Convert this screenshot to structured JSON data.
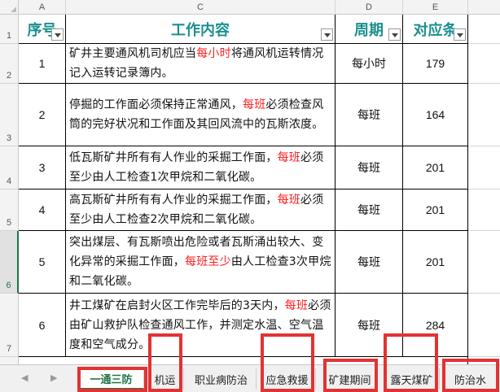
{
  "columns": [
    "A",
    "C",
    "D",
    "E"
  ],
  "header_row_number": "1",
  "headers": [
    "序号",
    "工作内容",
    "周期",
    "对应条"
  ],
  "rows": [
    {
      "row_number": "2",
      "seq": "1",
      "content": [
        [
          "矿井主要通风机司机应当",
          ""
        ],
        [
          "每小时",
          "red"
        ],
        [
          "将通风机运转情况记入运转记录簿内。",
          ""
        ]
      ],
      "period": "每小时",
      "clause": "179"
    },
    {
      "row_number": "3",
      "seq": "2",
      "content": [
        [
          "停掘的工作面必须保持正常通风，",
          ""
        ],
        [
          "每班",
          "red"
        ],
        [
          "必须检查风筒的完好状况和工作面及其回风流中的瓦斯浓度。",
          ""
        ]
      ],
      "period": "每班",
      "clause": "164"
    },
    {
      "row_number": "4",
      "seq": "3",
      "content": [
        [
          "低瓦斯矿井所有有人作业的采掘工作面，",
          ""
        ],
        [
          "每班",
          "red"
        ],
        [
          "必须至少由人工检查1次甲烷和二氧化碳。",
          ""
        ]
      ],
      "period": "每班",
      "clause": "201"
    },
    {
      "row_number": "5",
      "seq": "4",
      "content": [
        [
          "高瓦斯矿井所有有人作业的采掘工作面，",
          ""
        ],
        [
          "每班",
          "red"
        ],
        [
          "必须至少由人工检查2次甲烷和二氧化碳。",
          ""
        ]
      ],
      "period": "每班",
      "clause": "201"
    },
    {
      "row_number": "6",
      "seq": "5",
      "content": [
        [
          "突出煤层、有瓦斯喷出危险或者瓦斯涌出较大、变化异常的采掘工作面，",
          ""
        ],
        [
          "每班至少",
          "red"
        ],
        [
          "由人工检查3次甲烷和二氧化碳。",
          ""
        ]
      ],
      "period": "每班",
      "clause": "201"
    },
    {
      "row_number": "7",
      "seq": "6",
      "content": [
        [
          "井工煤矿在启封火区工作完毕后的3天内，",
          ""
        ],
        [
          "每班",
          "red"
        ],
        [
          "必须由矿山救护队检查通风工作，并测定水温、空气温度和空气成分。",
          ""
        ]
      ],
      "period": "每班",
      "clause": "284"
    }
  ],
  "tabs": [
    {
      "label": "一通三防",
      "active": true
    },
    {
      "label": "机运",
      "active": false
    },
    {
      "label": "职业病防治",
      "active": false
    },
    {
      "label": "应急救援",
      "active": false
    },
    {
      "label": "矿建期间",
      "active": false
    },
    {
      "label": "露天煤矿",
      "active": false
    },
    {
      "label": "防治水",
      "active": false
    }
  ],
  "nav": {
    "prev": "◀",
    "next": "▶"
  },
  "colors": {
    "accent": "#217346",
    "header_text": "#1a8f8f",
    "highlight_text": "#ff1f1f",
    "annotation_box": "#e33232"
  }
}
